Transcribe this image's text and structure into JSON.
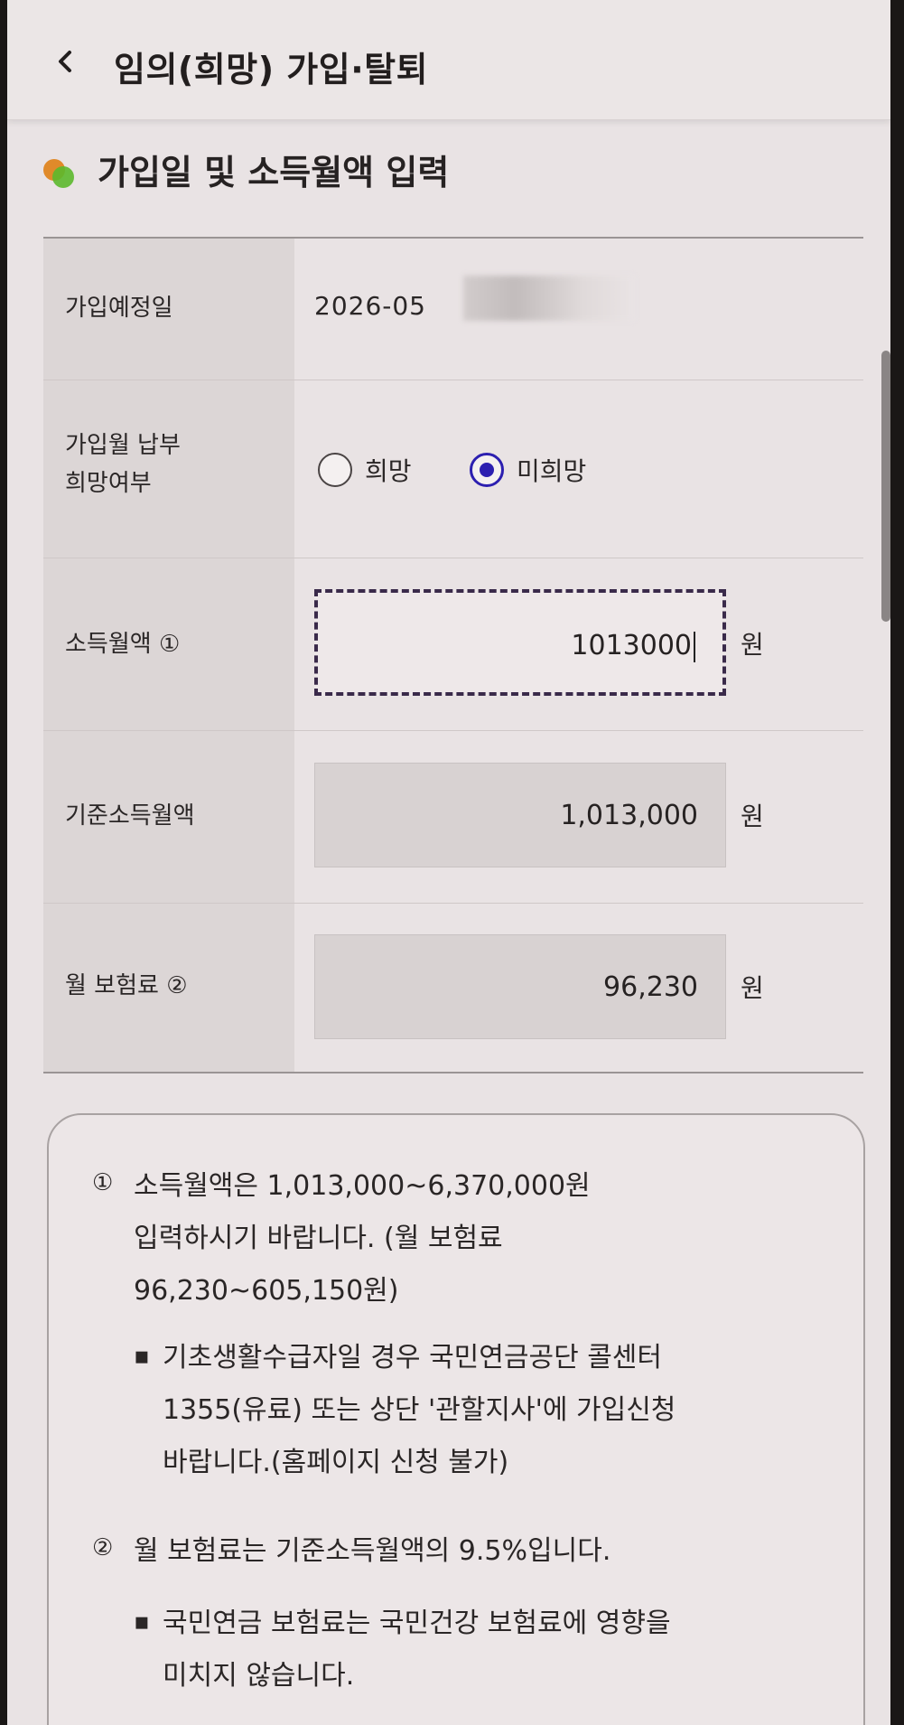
{
  "header": {
    "title": "임의(희망) 가입·탈퇴",
    "back_icon": "chevron-left-icon"
  },
  "section": {
    "title": "가입일 및 소득월액 입력",
    "icon": "two-tone-dot-icon",
    "icon_colors": [
      "#e08a2a",
      "#5cb82c"
    ]
  },
  "rows": {
    "join_date": {
      "label": "가입예정일",
      "value": "2026-05"
    },
    "payment_preference": {
      "label_line1": "가입월 납부",
      "label_line2": "희망여부",
      "options": [
        {
          "label": "희망",
          "selected": false
        },
        {
          "label": "미희망",
          "selected": true
        }
      ]
    },
    "monthly_income": {
      "label": "소득월액 ①",
      "value": "1013000",
      "unit": "원"
    },
    "standard_income": {
      "label": "기준소득월액",
      "value": "1,013,000",
      "unit": "원"
    },
    "monthly_premium": {
      "label": "월 보험료 ②",
      "value": "96,230",
      "unit": "원"
    }
  },
  "notice": {
    "note1": {
      "marker": "①",
      "line1": "소득월액은 1,013,000~6,370,000원",
      "line2": "입력하시기 바랍니다. (월 보험료",
      "line3": "96,230~605,150원)",
      "bullet": "▪",
      "sub_line1": "기초생활수급자일 경우 국민연금공단 콜센터",
      "sub_line2": "1355(유료) 또는 상단 '관할지사'에 가입신청",
      "sub_line3": "바랍니다.(홈페이지 신청 불가)"
    },
    "note2": {
      "marker": "②",
      "line1": "월 보험료는 기준소득월액의 9.5%입니다.",
      "bullet": "▪",
      "sub_line1": "국민연금 보험료는 국민건강 보험료에 영향을",
      "sub_line2": "미치지 않습니다."
    }
  },
  "colors": {
    "radio_selected": "#2c1fb0",
    "label_bg": "#dcd6d6",
    "readonly_bg": "#d8d2d2"
  }
}
